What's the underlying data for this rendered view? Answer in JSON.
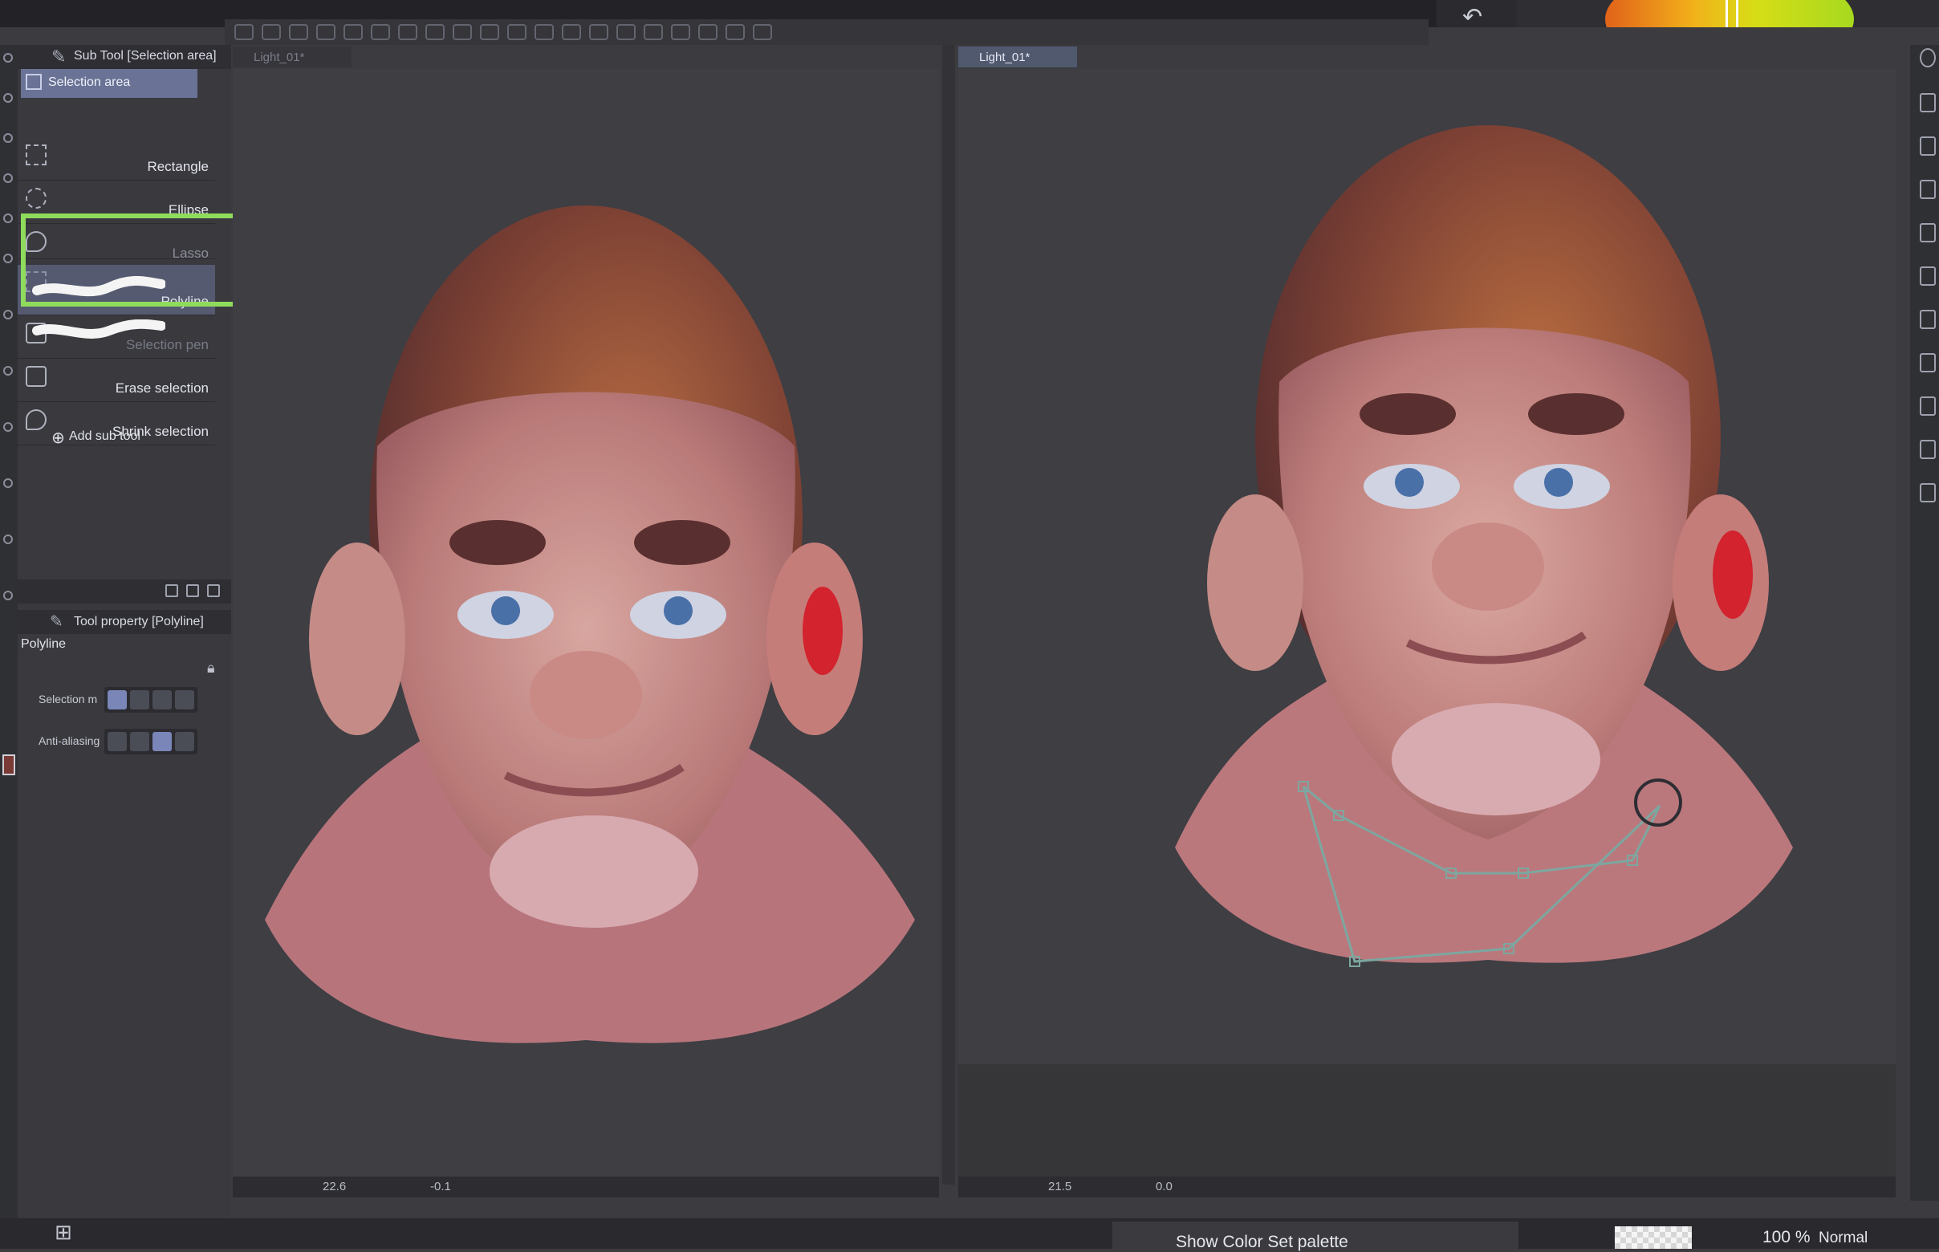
{
  "app": {
    "undo_icon": "undo-icon",
    "accent": "#6a7396",
    "highlight_color": "#8fdc5c"
  },
  "subtool_panel": {
    "title": "Sub Tool [Selection area]",
    "active_tab": "Selection area",
    "items": [
      {
        "label": "Rectangle",
        "icon": "rectangle-select-icon"
      },
      {
        "label": "Ellipse",
        "icon": "ellipse-select-icon"
      },
      {
        "label": "Lasso",
        "icon": "lasso-icon"
      },
      {
        "label": "Polyline",
        "icon": "polyline-icon",
        "selected": true
      },
      {
        "label": "Selection pen",
        "icon": "selection-pen-icon"
      },
      {
        "label": "Erase selection",
        "icon": "erase-selection-icon"
      },
      {
        "label": "Shrink selection",
        "icon": "shrink-selection-icon"
      }
    ],
    "add_sub_tool": "Add sub tool"
  },
  "tool_property": {
    "title": "Tool property [Polyline]",
    "tool_name": "Polyline",
    "selection_mode_label": "Selection m",
    "anti_aliasing_label": "Anti-aliasing"
  },
  "canvases": {
    "left": {
      "tab": "Light_01*",
      "zoom": "22.6",
      "angle": "-0.1"
    },
    "right": {
      "tab": "Light_01*",
      "zoom": "21.5",
      "angle": "0.0"
    }
  },
  "bottom": {
    "color_set": "Show Color Set palette",
    "opacity": "100 %",
    "blend_mode": "Normal"
  }
}
